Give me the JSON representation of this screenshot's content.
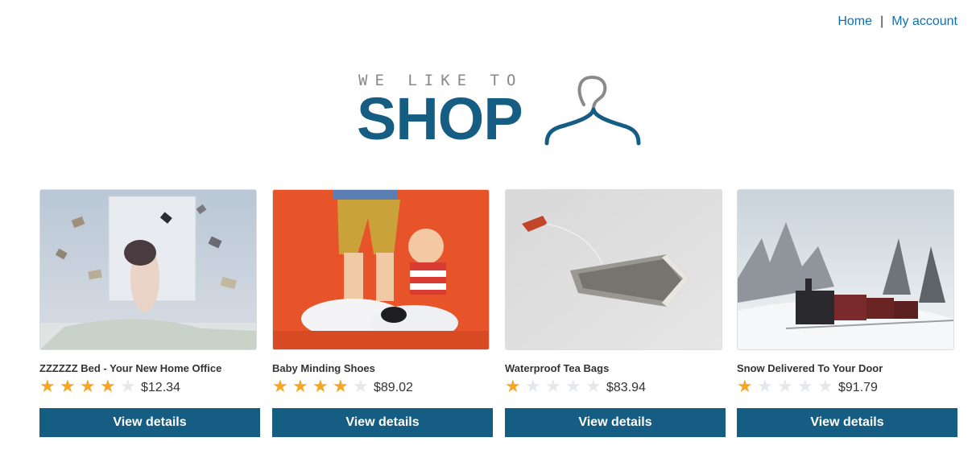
{
  "nav": {
    "home": "Home",
    "separator": "|",
    "account": "My account"
  },
  "logo": {
    "tagline": "WE LIKE TO",
    "brand": "SHOP"
  },
  "colors": {
    "accent": "#155d82",
    "link": "#0e6fb4",
    "star": "#f5a623",
    "star_off": "#e4e8ec"
  },
  "products": [
    {
      "name": "ZZZZZZ Bed - Your New Home Office",
      "rating": 4,
      "max_rating": 5,
      "price": "$12.34",
      "button": "View details"
    },
    {
      "name": "Baby Minding Shoes",
      "rating": 4,
      "max_rating": 5,
      "price": "$89.02",
      "button": "View details"
    },
    {
      "name": "Waterproof Tea Bags",
      "rating": 1,
      "max_rating": 5,
      "price": "$83.94",
      "button": "View details"
    },
    {
      "name": "Snow Delivered To Your Door",
      "rating": 1,
      "max_rating": 5,
      "price": "$91.79",
      "button": "View details"
    }
  ]
}
